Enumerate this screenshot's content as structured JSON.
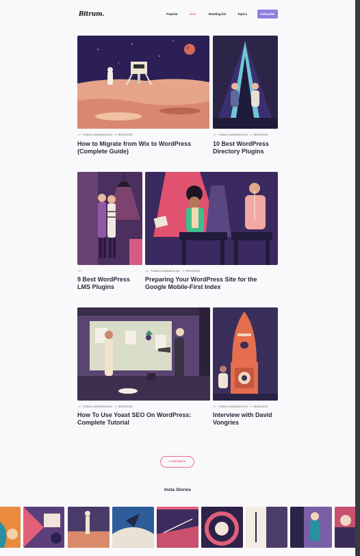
{
  "brand": {
    "logo": "Bitrum."
  },
  "nav": {
    "items": [
      {
        "label": "Popular"
      },
      {
        "label": "New"
      },
      {
        "label": "Reading list"
      },
      {
        "label": "Topics"
      }
    ],
    "subscribe": "Subscribe"
  },
  "posts": [
    {
      "author": "TOMAS LAURINAVICIUS",
      "by": "BY",
      "in": "IN",
      "category": "RESOURCE",
      "title": "How to Migrate from Wix to WordPress (Complete Guide)"
    },
    {
      "author": "TOMAS LAURINAVICIUS",
      "by": "BY",
      "in": "IN",
      "category": "RESOURCE",
      "title": "10 Best WordPress Directory Plugins"
    },
    {
      "author": "",
      "by": "BY",
      "in": "",
      "category": "",
      "title": "9 Best WordPress LMS Plugins"
    },
    {
      "author": "TOMAS LAURINAVICIUS",
      "by": "BY",
      "in": "IN",
      "category": "RESOURCE",
      "title": "Preparing Your WordPress Site for the Google Mobile-First Index"
    },
    {
      "author": "TOMAS LAURINAVICIUS",
      "by": "BY",
      "in": "IN",
      "category": "RESOURCE",
      "title": "How To Use Yoast SEO On WordPress: Complete Tutorial"
    },
    {
      "author": "TOMAS LAURINAVICIUS",
      "by": "BY",
      "in": "IN",
      "category": "RESOURCE",
      "title": "Interview with David Vongries"
    }
  ],
  "load_more": "Load More",
  "insta": {
    "heading": "Insta Stories"
  },
  "colors": {
    "accent": "#ef6a86",
    "subscribe": "#8c7fe0",
    "dark_purple": "#2e2451"
  }
}
